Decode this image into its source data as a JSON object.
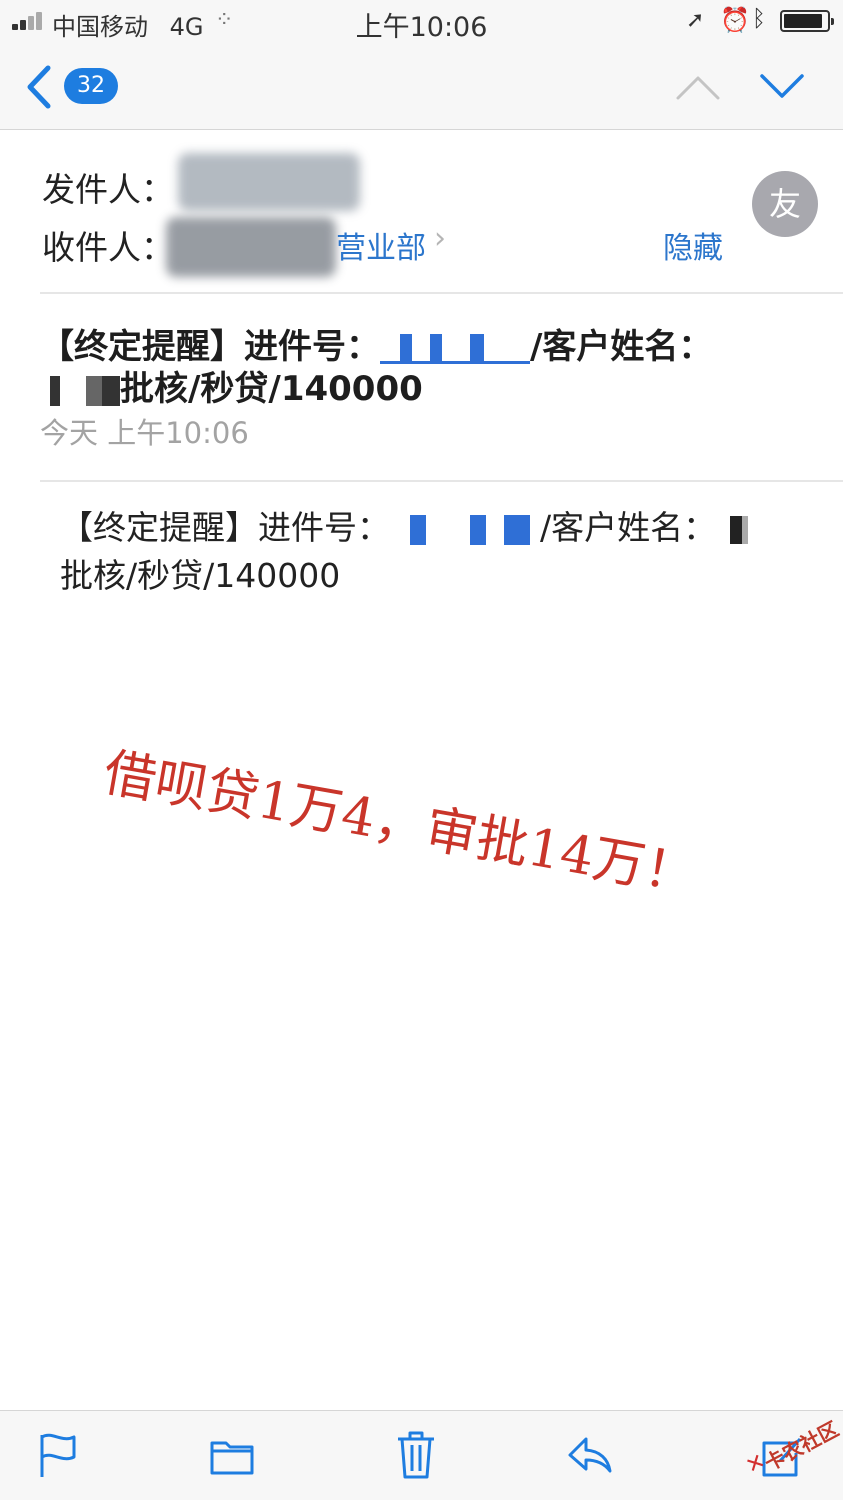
{
  "status_bar": {
    "carrier": "中国移动",
    "network": "4G",
    "time": "上午10:06"
  },
  "nav": {
    "unread_count": "32"
  },
  "header": {
    "from_label": "发件人：",
    "to_label": "收件人：",
    "recipient_visible": "营业部",
    "hide_label": "隐藏",
    "avatar_initial": "友"
  },
  "message": {
    "subject_part1": "【终定提醒】进件号：",
    "subject_part2": "/客户姓名：",
    "subject_part3": "批核/秒贷/140000",
    "datetime": "今天 上午10:06",
    "body_part1": "【终定提醒】进件号：",
    "body_part2": "/客户姓名：",
    "body_part3": "批核/秒贷/140000"
  },
  "annotation": {
    "text": "借呗贷1万4，审批14万！",
    "color": "#c9352a"
  },
  "watermark": {
    "text": "卡农社区"
  },
  "colors": {
    "accent": "#2c76cc",
    "badge": "#1e7de0"
  }
}
